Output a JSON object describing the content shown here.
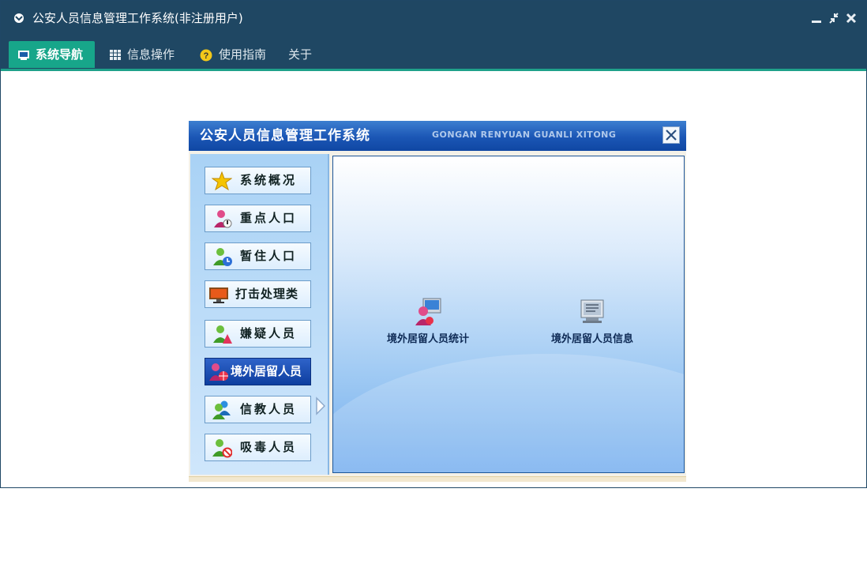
{
  "window": {
    "title": "公安人员信息管理工作系统(非注册用户)",
    "controls": [
      "minimize-icon",
      "restore-icon",
      "close-icon"
    ],
    "colors": {
      "titlebar": "#1f4763",
      "active_tab": "#17a68a"
    }
  },
  "menu": {
    "items": [
      {
        "label": "系统导航",
        "icon": "monitor-icon",
        "active": true
      },
      {
        "label": "信息操作",
        "icon": "grid-icon",
        "active": false
      },
      {
        "label": "使用指南",
        "icon": "help-icon",
        "active": false
      },
      {
        "label": "关于",
        "active": false
      }
    ]
  },
  "inner_app": {
    "title": "公安人员信息管理工作系统",
    "subtitle_pinyin": "GONGAN RENYUAN GUANLI XITONG",
    "close_icon": "close-icon",
    "nav": [
      {
        "label": "系统概况",
        "icon": "star-icon"
      },
      {
        "label": "重点人口",
        "icon": "person-alert-icon"
      },
      {
        "label": "暂住人口",
        "icon": "person-clock-icon"
      },
      {
        "label": "打击处理类",
        "icon": "monitor-icon"
      },
      {
        "label": "嫌疑人员",
        "icon": "person-warning-icon"
      },
      {
        "label": "境外居留人员",
        "icon": "person-globe-icon",
        "active": true
      },
      {
        "label": "信教人员",
        "icon": "people-icon"
      },
      {
        "label": "吸毒人员",
        "icon": "person-ban-icon"
      }
    ],
    "features": [
      {
        "label": "境外居留人员统计",
        "icon": "people-chart-icon"
      },
      {
        "label": "境外居留人员信息",
        "icon": "document-icon"
      }
    ]
  }
}
